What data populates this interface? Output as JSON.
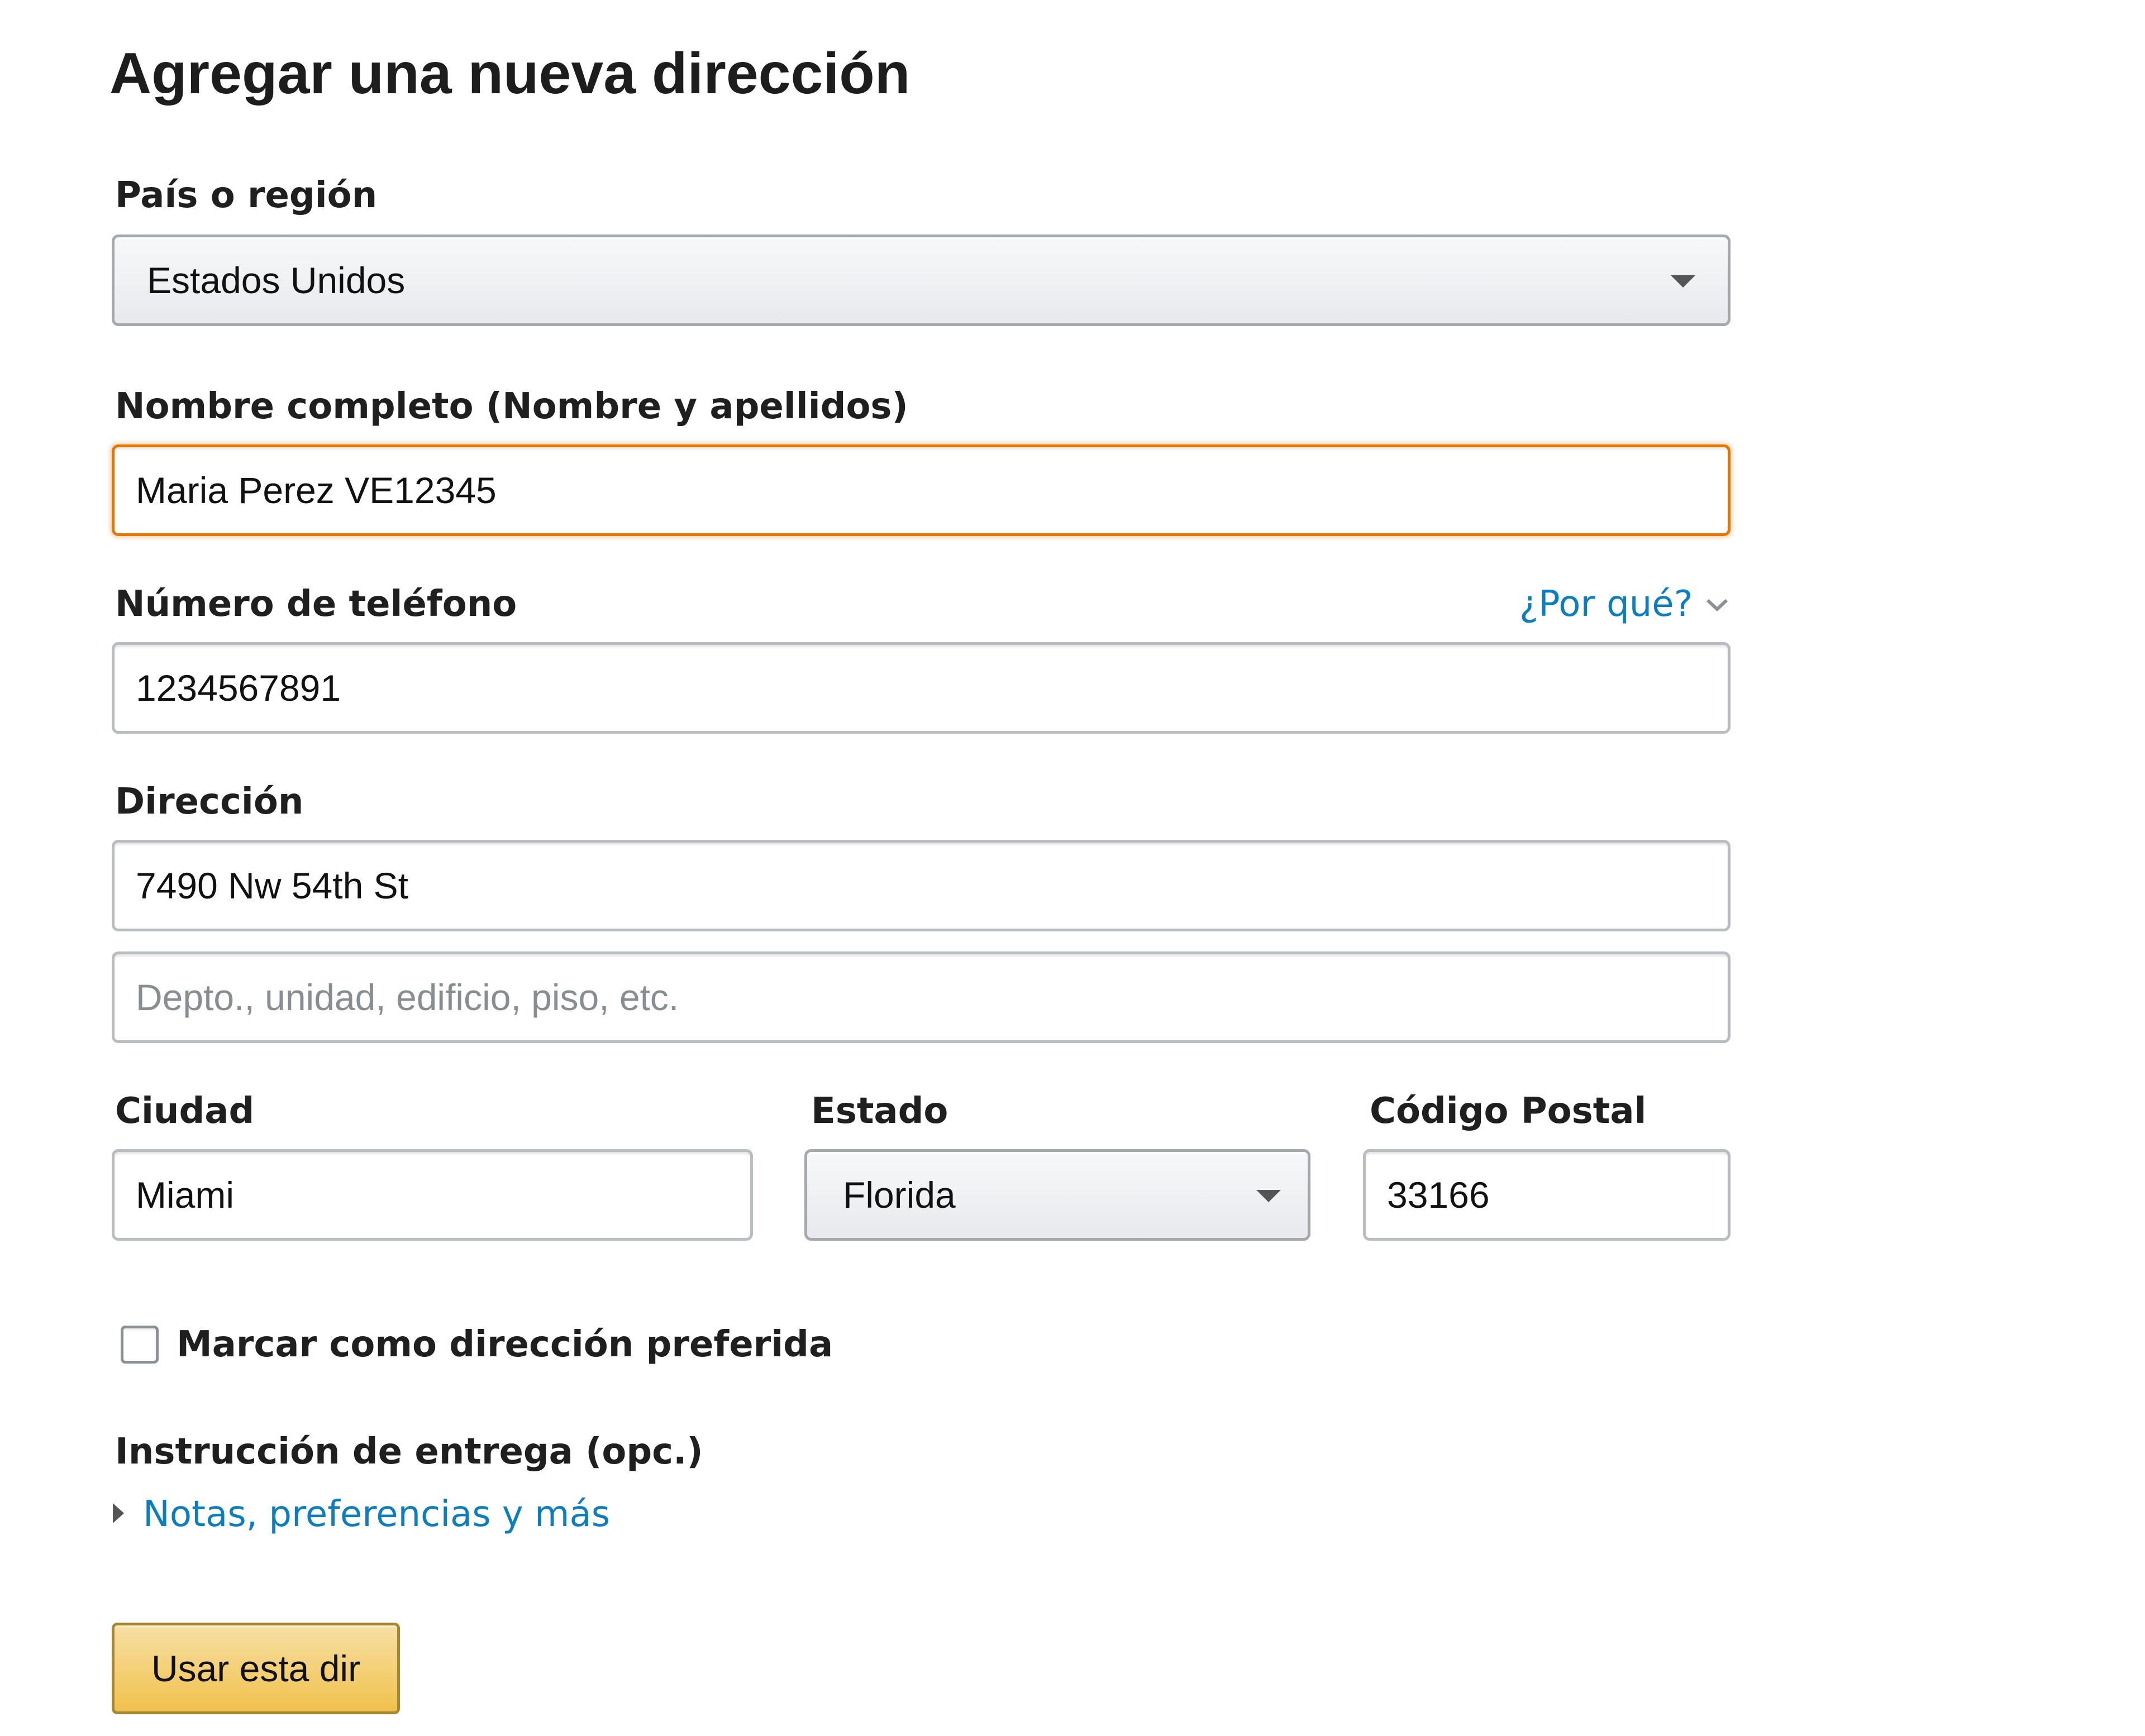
{
  "page": {
    "title": "Agregar una nueva dirección"
  },
  "country": {
    "label": "País o región",
    "selected": "Estados Unidos"
  },
  "full_name": {
    "label": "Nombre completo (Nombre y apellidos)",
    "value": "Maria Perez VE12345"
  },
  "phone": {
    "label": "Número de teléfono",
    "why_link": "¿Por qué?",
    "value": "1234567891"
  },
  "address": {
    "label": "Dirección",
    "line1_value": "7490 Nw 54th St",
    "line2_placeholder": "Depto., unidad, edificio, piso, etc."
  },
  "city": {
    "label": "Ciudad",
    "value": "Miami"
  },
  "state": {
    "label": "Estado",
    "selected": "Florida"
  },
  "postal": {
    "label": "Código Postal",
    "value": "33166"
  },
  "preferred": {
    "label": "Marcar como dirección preferida",
    "checked": false
  },
  "delivery": {
    "label": "Instrucción de entrega (opc.)",
    "link": "Notas, preferencias y más"
  },
  "submit": {
    "label": "Usar esta dir"
  },
  "colors": {
    "link": "#0c7dbf",
    "focus_border": "#e77600",
    "button_top": "#f7dfa5",
    "button_bottom": "#f0c14b"
  }
}
